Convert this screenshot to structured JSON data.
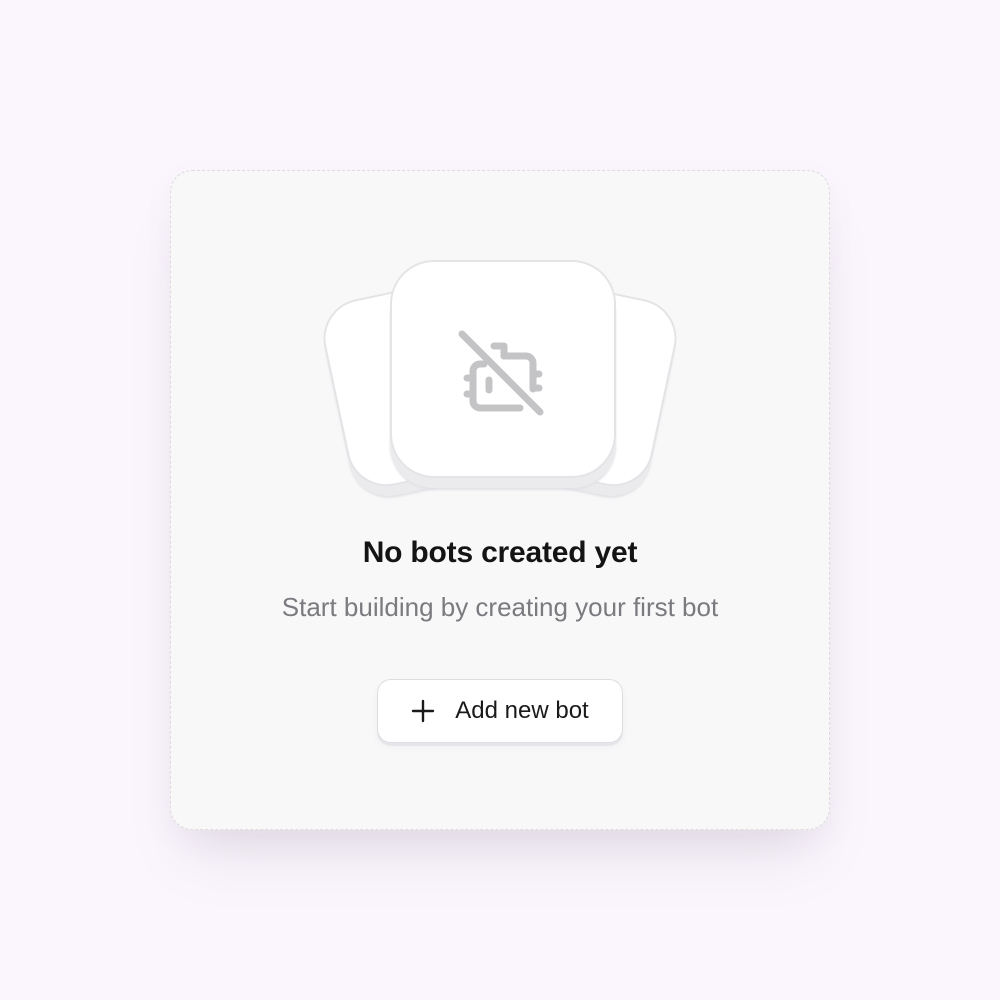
{
  "empty_state": {
    "icon": "bot-off-icon",
    "title": "No bots created yet",
    "subtitle": "Start building by creating your first bot"
  },
  "actions": {
    "add_button": {
      "icon": "plus-icon",
      "label": "Add new bot"
    }
  },
  "colors": {
    "background": "#fbf6fd",
    "card": "#f8f8f9",
    "icon": "#c4c4c7",
    "title": "#141414",
    "subtitle": "#7a7a7f"
  }
}
